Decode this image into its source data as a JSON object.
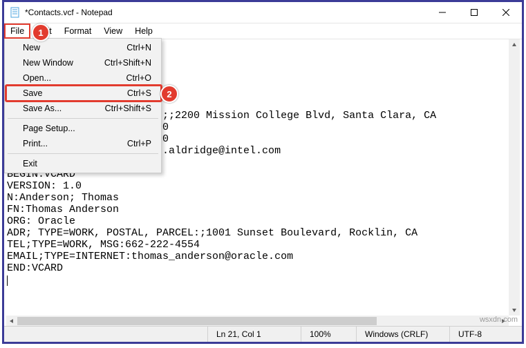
{
  "window": {
    "title": "*Contacts.vcf - Notepad"
  },
  "menubar": {
    "file": "File",
    "edit": "Edit",
    "format": "Format",
    "view": "View",
    "help": "Help"
  },
  "file_menu": {
    "new": "New",
    "new_sc": "Ctrl+N",
    "new_window": "New Window",
    "new_window_sc": "Ctrl+Shift+N",
    "open": "Open...",
    "open_sc": "Ctrl+O",
    "save": "Save",
    "save_sc": "Ctrl+S",
    "save_as": "Save As...",
    "save_as_sc": "Ctrl+Shift+S",
    "page_setup": "Page Setup...",
    "print": "Print...",
    "print_sc": "Ctrl+P",
    "exit": "Exit"
  },
  "callouts": {
    "one": "1",
    "two": "2"
  },
  "editor_lines": {
    "l1": "",
    "l2": "",
    "l3": "",
    "l4": "",
    "l5": "",
    "l6": "",
    "l7": "                       L:;;2200 Mission College Blvd, Santa Clara, CA",
    "l8": "                       800",
    "l9": "                       900",
    "l10": "                       th.aldridge@intel.com",
    "l11": "",
    "l12": "BEGIN:VCARD",
    "l13": "VERSION: 1.0",
    "l14": "N:Anderson; Thomas",
    "l15": "FN:Thomas Anderson",
    "l16": "ORG: Oracle",
    "l17": "ADR; TYPE=WORK, POSTAL, PARCEL:;1001 Sunset Boulevard, Rocklin, CA",
    "l18": "TEL;TYPE=WORK, MSG:662-222-4554",
    "l19": "EMAIL;TYPE=INTERNET:thomas_anderson@oracle.com",
    "l20": "END:VCARD"
  },
  "status": {
    "position": "Ln 21, Col 1",
    "zoom": "100%",
    "eol": "Windows (CRLF)",
    "encoding": "UTF-8"
  },
  "watermark": "wsxdn.com"
}
